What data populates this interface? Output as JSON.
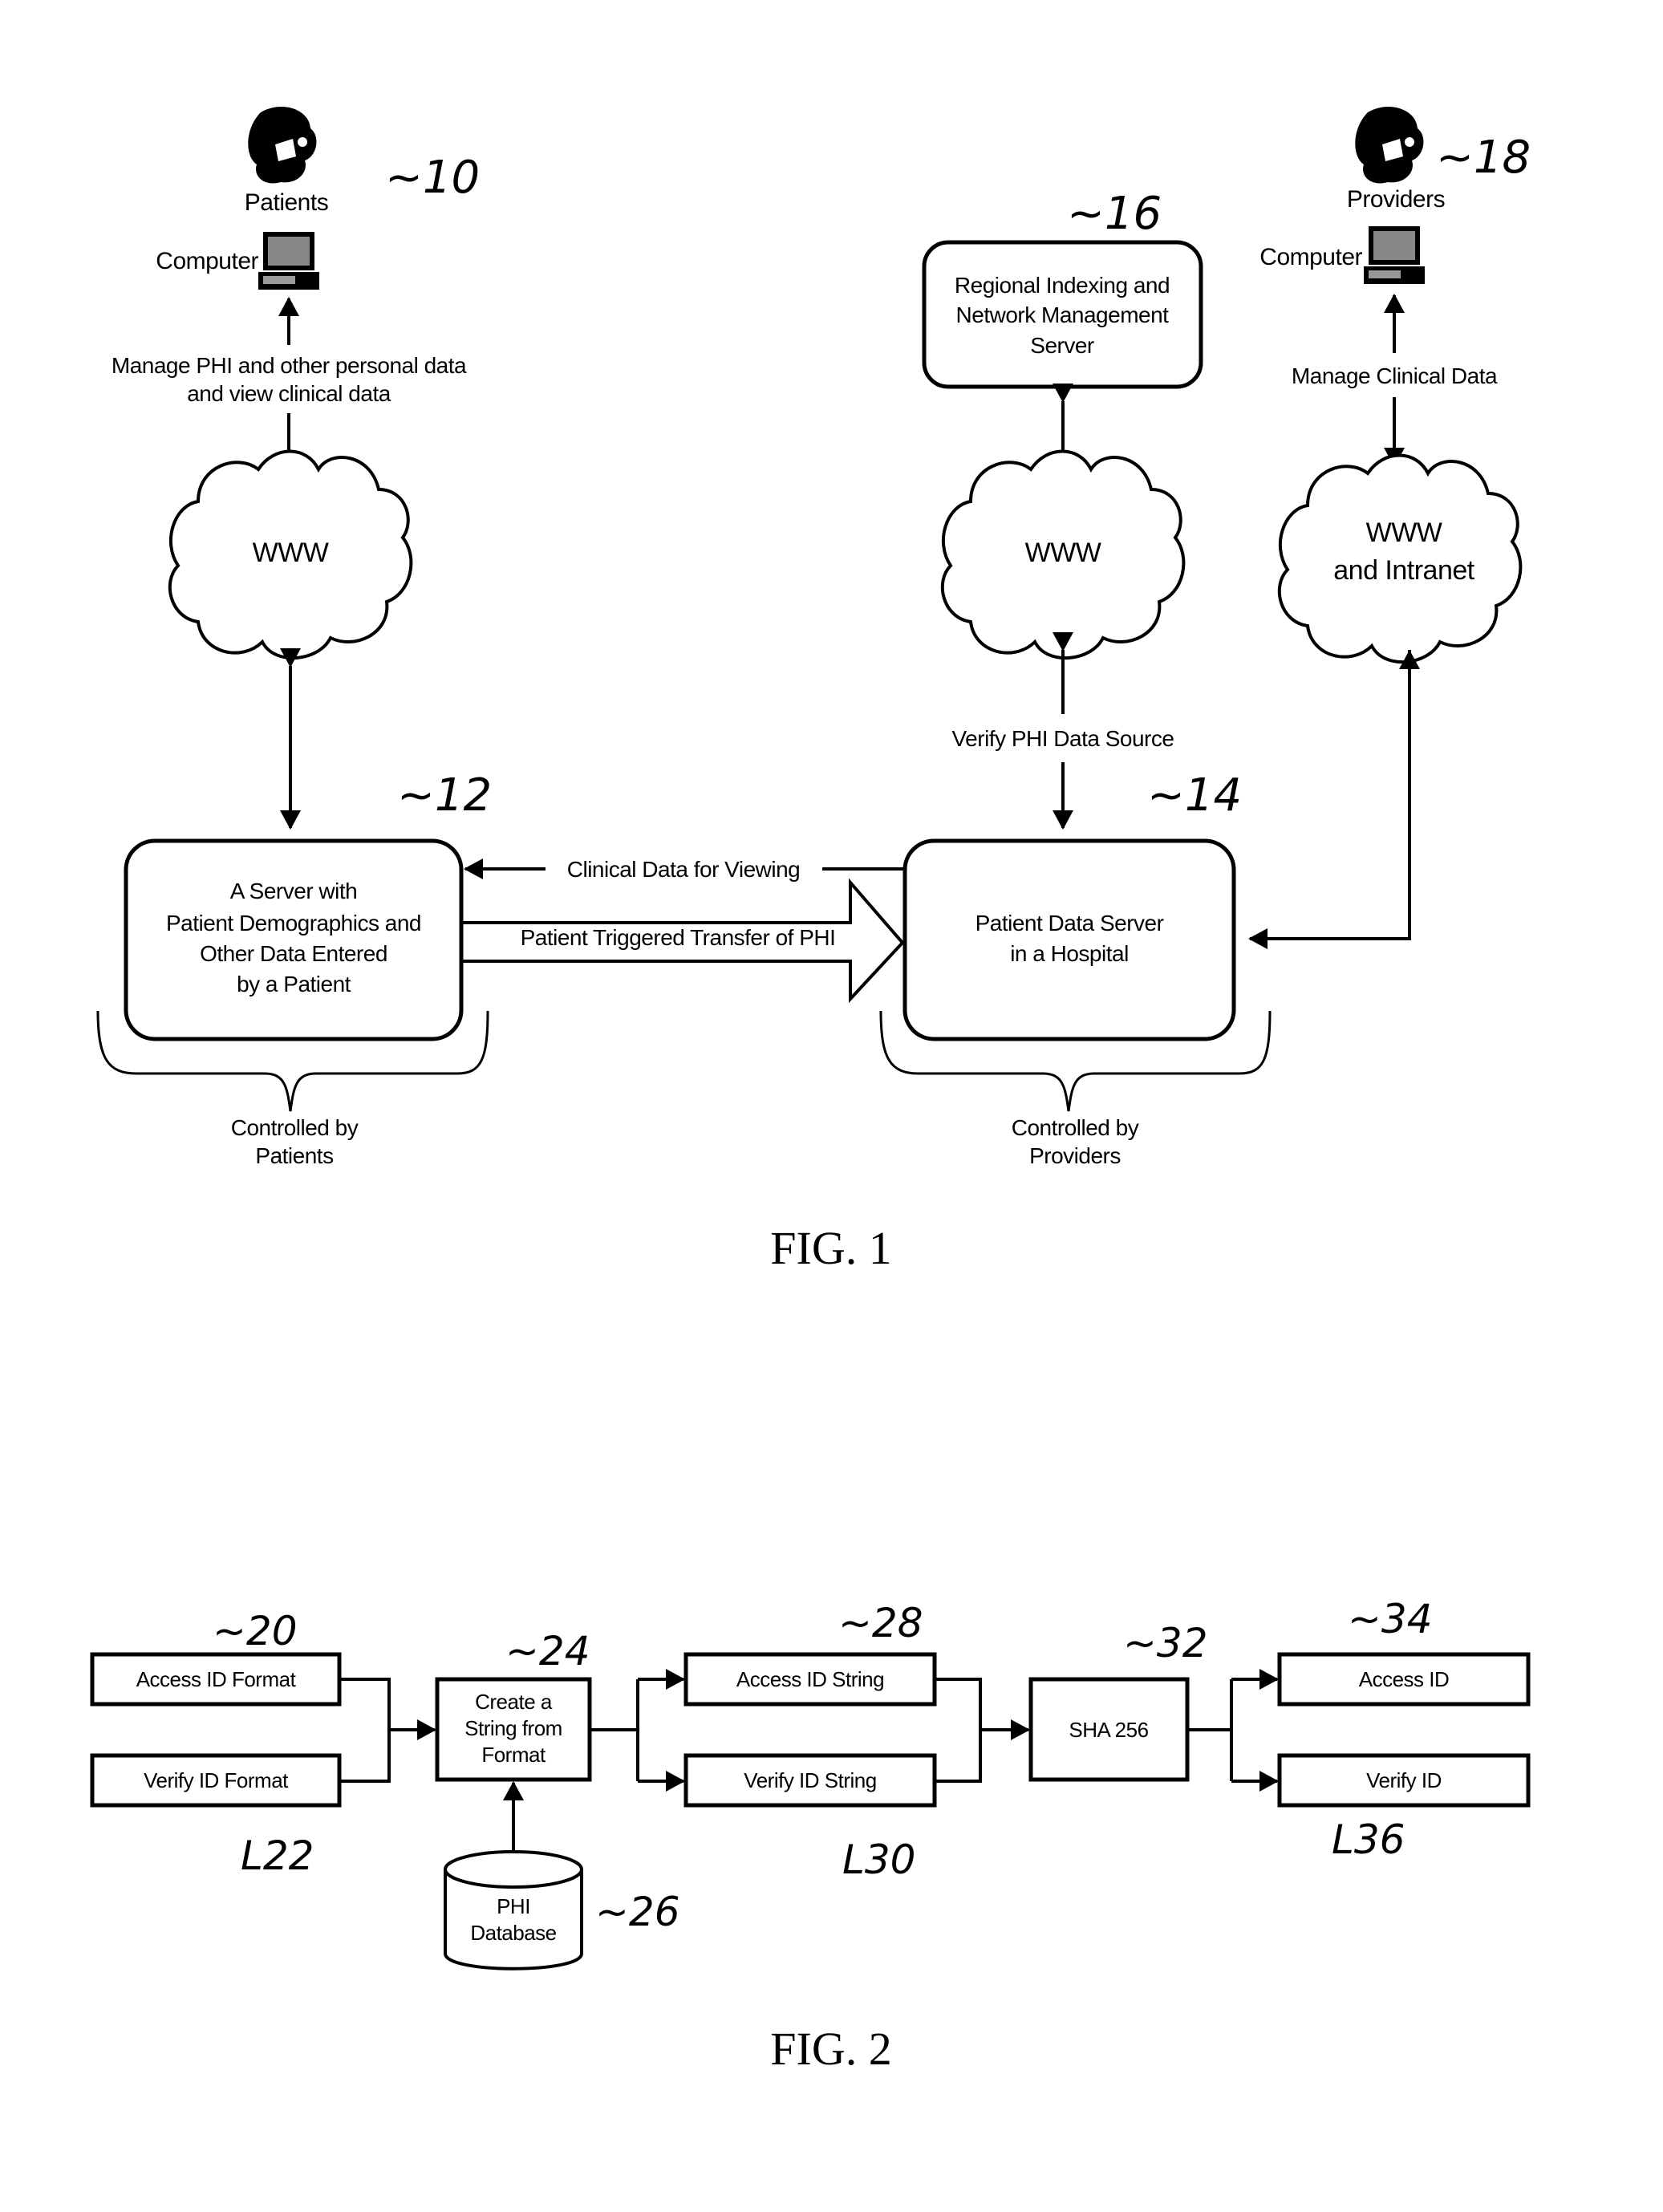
{
  "fig1": {
    "caption": "FIG. 1",
    "patients": {
      "label": "Patients",
      "ref": "10",
      "icon": "person-icon"
    },
    "providers": {
      "label": "Providers",
      "ref": "18",
      "icon": "person-icon"
    },
    "patient_computer": {
      "label": "Computer",
      "icon": "computer-icon"
    },
    "provider_computer": {
      "label": "Computer",
      "icon": "computer-icon"
    },
    "patient_link_label": [
      "Manage PHI and other personal data",
      "and view clinical data"
    ],
    "provider_link_label": "Manage Clinical Data",
    "cloud_left": {
      "lines": [
        "WWW"
      ]
    },
    "cloud_middle": {
      "lines": [
        "WWW"
      ]
    },
    "cloud_right": {
      "lines": [
        "WWW",
        "and Intranet"
      ]
    },
    "indexing_server": {
      "lines": [
        "Regional Indexing and",
        "Network Management",
        "Server"
      ],
      "ref": "16"
    },
    "verify_label": "Verify PHI Data Source",
    "patient_server": {
      "lines": [
        "A Server with",
        "Patient Demographics and",
        "Other Data Entered",
        "by a Patient"
      ],
      "ref": "12"
    },
    "hospital_server": {
      "lines": [
        "Patient Data Server",
        "in a Hospital"
      ],
      "ref": "14"
    },
    "clinical_arrow_label": "Clinical Data for Viewing",
    "transfer_arrow_label": "Patient Triggered Transfer of PHI",
    "brace_left": [
      "Controlled by",
      "Patients"
    ],
    "brace_right": [
      "Controlled by",
      "Providers"
    ]
  },
  "fig2": {
    "caption": "FIG. 2",
    "access_format": {
      "label": "Access ID Format",
      "ref": "20"
    },
    "verify_format": {
      "label": "Verify ID Format",
      "ref": "22"
    },
    "create_string": {
      "lines": [
        "Create a",
        "String from",
        "Format"
      ],
      "ref": "24"
    },
    "phi_database": {
      "lines": [
        "PHI",
        "Database"
      ],
      "ref": "26"
    },
    "access_string": {
      "label": "Access ID String",
      "ref": "28"
    },
    "verify_string": {
      "label": "Verify ID String",
      "ref": "30"
    },
    "sha": {
      "label": "SHA 256",
      "ref": "32"
    },
    "access_id": {
      "label": "Access ID",
      "ref": "34"
    },
    "verify_id": {
      "label": "Verify ID",
      "ref": "36"
    }
  }
}
